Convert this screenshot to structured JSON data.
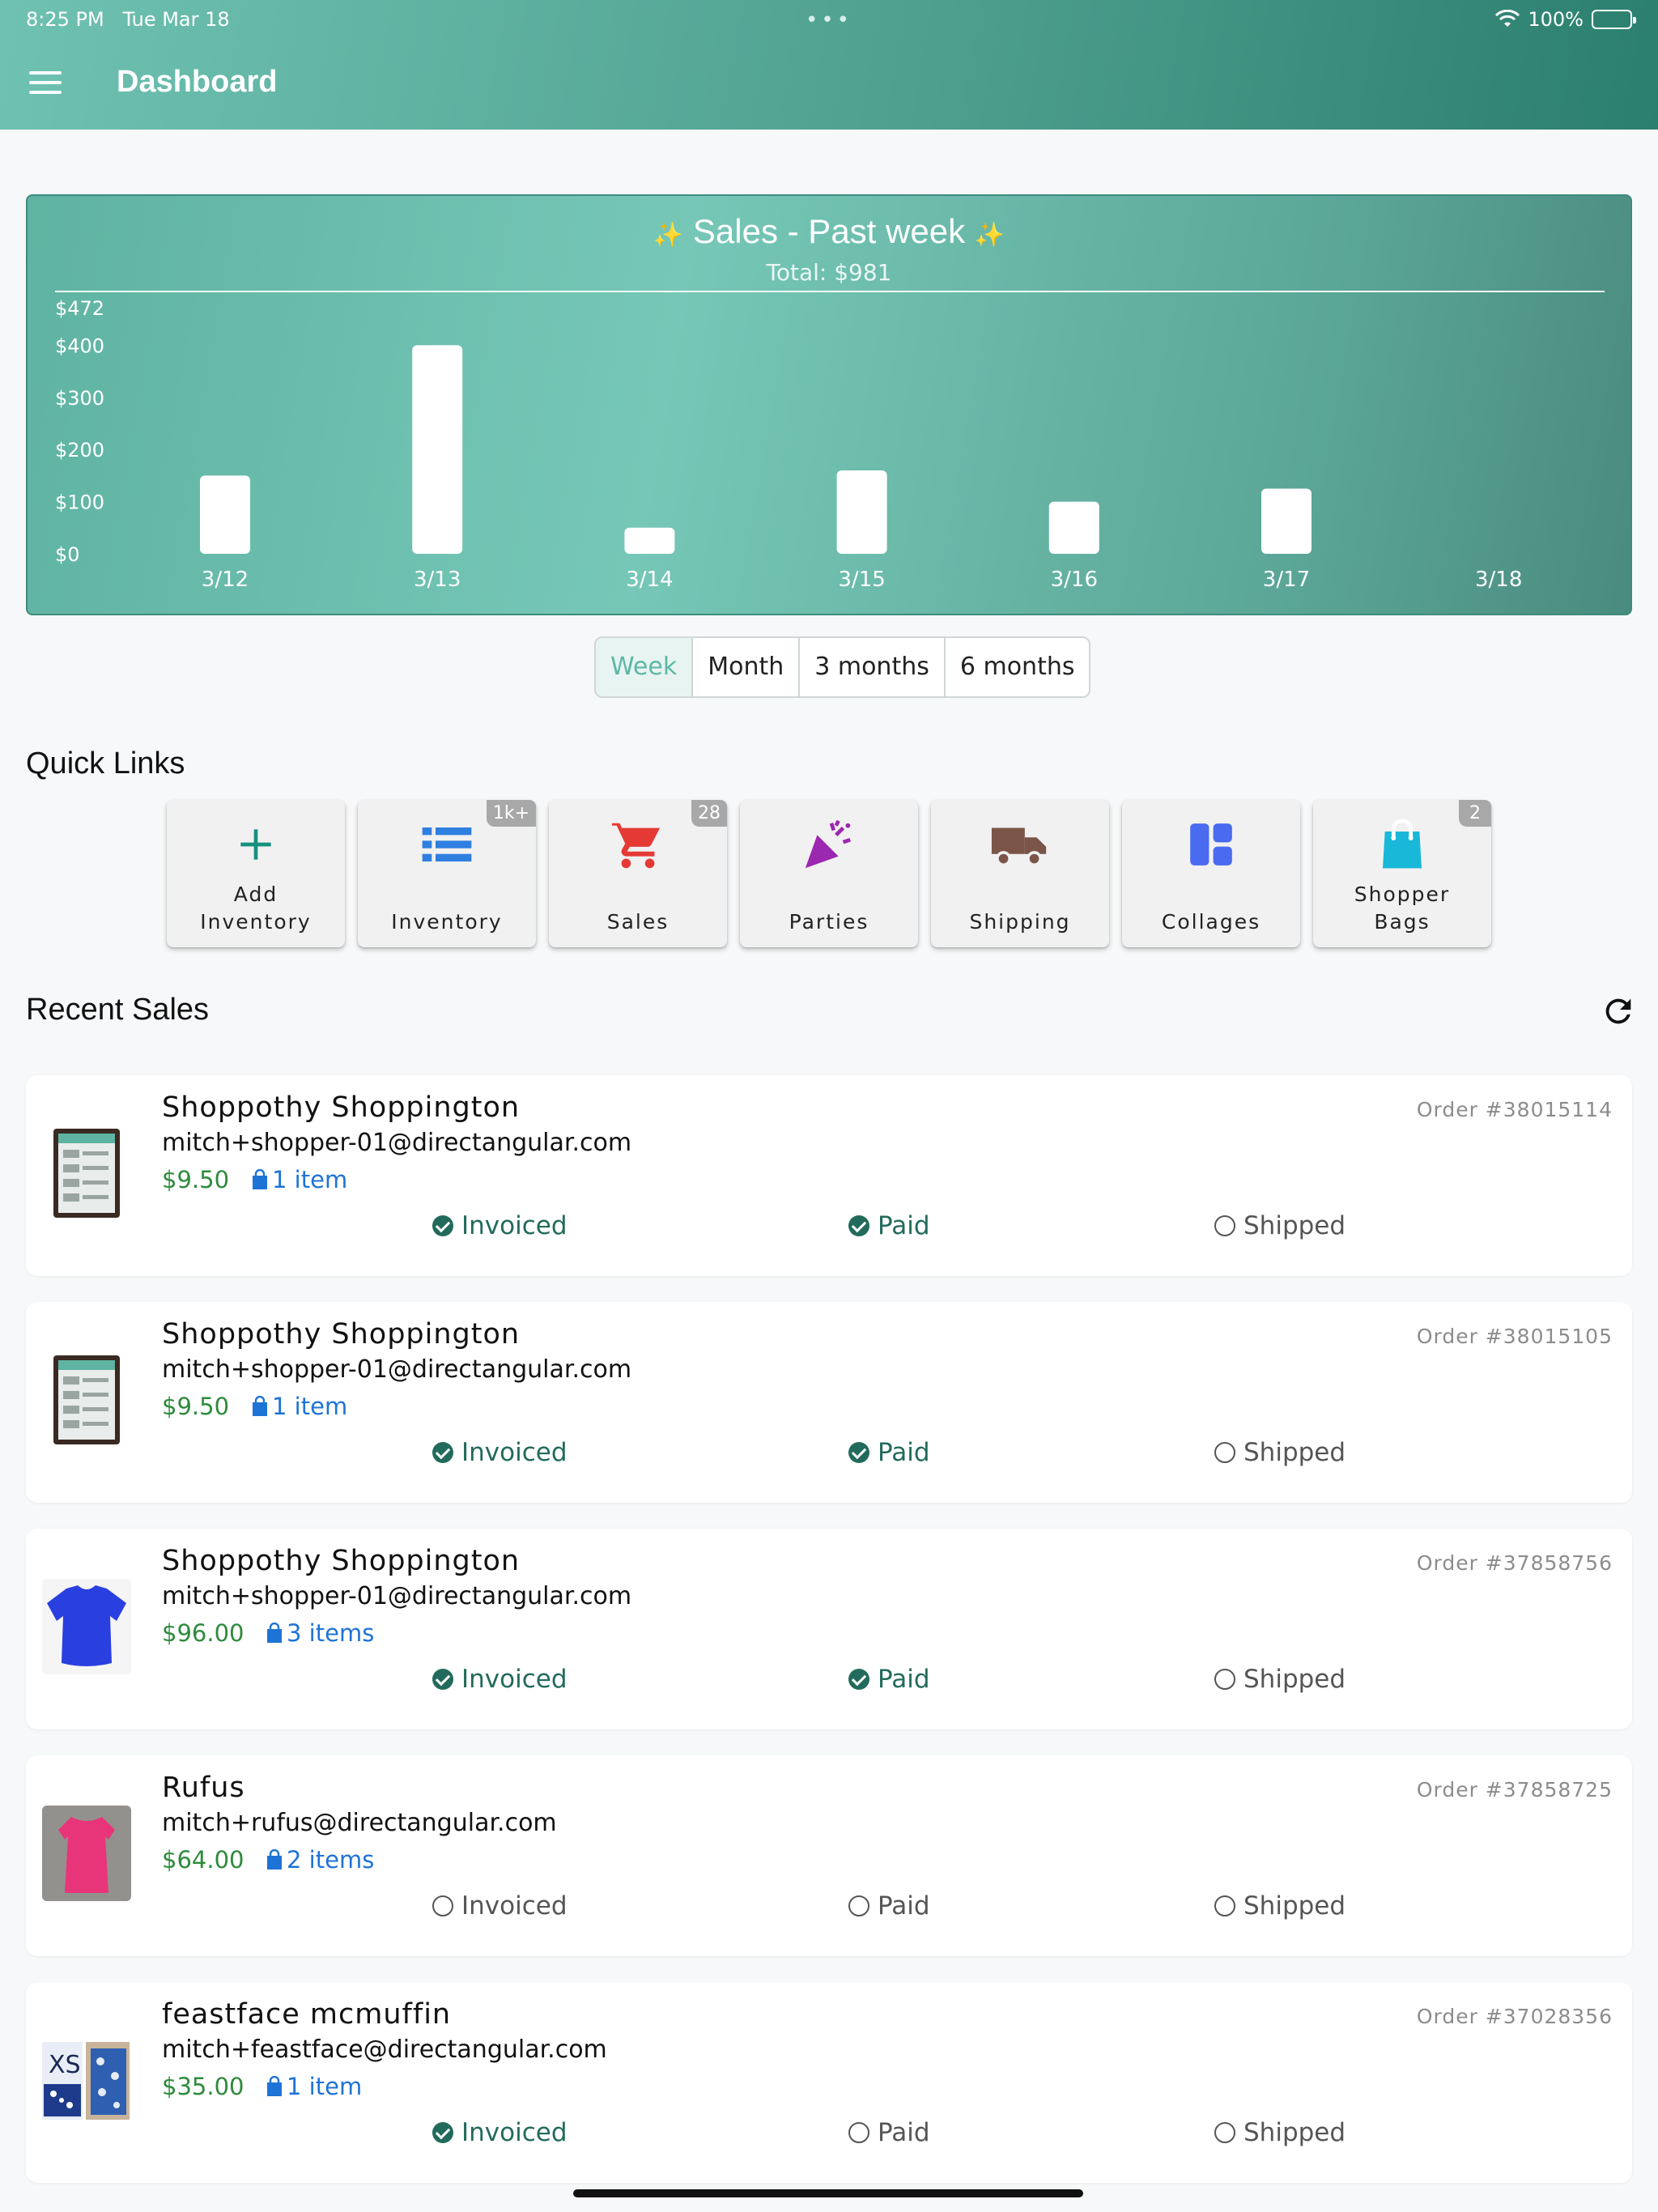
{
  "status_bar": {
    "time": "8:25 PM",
    "date": "Tue Mar 18",
    "battery": "100%"
  },
  "header": {
    "title": "Dashboard"
  },
  "chart_data": {
    "type": "bar",
    "title": "Sales - Past week",
    "subtitle": "Total: $981",
    "categories": [
      "3/12",
      "3/13",
      "3/14",
      "3/15",
      "3/16",
      "3/17",
      "3/18"
    ],
    "values": [
      150,
      400,
      50,
      160,
      100,
      125,
      0
    ],
    "y_ticks": [
      "$472",
      "$400",
      "$300",
      "$200",
      "$100",
      "$0"
    ],
    "ylim": [
      0,
      472
    ],
    "grid": false,
    "colors": {
      "bar": "#ffffff",
      "background": "#6dbfae"
    }
  },
  "range_tabs": {
    "items": [
      "Week",
      "Month",
      "3 months",
      "6 months"
    ],
    "active": "Week"
  },
  "quick_links": {
    "heading": "Quick Links",
    "items": [
      {
        "line1": "Add",
        "line2": "Inventory",
        "badge": "",
        "icon": "plus-icon",
        "color": "#16907f"
      },
      {
        "line1": "",
        "line2": "Inventory",
        "badge": "1k+",
        "icon": "list-icon",
        "color": "#2f7fe0"
      },
      {
        "line1": "",
        "line2": "Sales",
        "badge": "28",
        "icon": "cart-icon",
        "color": "#e53935"
      },
      {
        "line1": "",
        "line2": "Parties",
        "badge": "",
        "icon": "party-popper-icon",
        "color": "#9c27b0"
      },
      {
        "line1": "",
        "line2": "Shipping",
        "badge": "",
        "icon": "truck-icon",
        "color": "#7a5548"
      },
      {
        "line1": "",
        "line2": "Collages",
        "badge": "",
        "icon": "collage-icon",
        "color": "#4a6bf0"
      },
      {
        "line1": "Shopper",
        "line2": "Bags",
        "badge": "2",
        "icon": "shopping-bag-icon",
        "color": "#19b8d8"
      }
    ]
  },
  "recent_sales": {
    "heading": "Recent Sales",
    "status_labels": {
      "invoiced": "Invoiced",
      "paid": "Paid",
      "shipped": "Shipped"
    },
    "items": [
      {
        "name": "Shoppothy Shoppington",
        "email": "mitch+shopper-01@directangular.com",
        "price": "$9.50",
        "items": "1 item",
        "order": "Order #38015114",
        "invoiced": true,
        "paid": true,
        "shipped": false,
        "thumb": "phone"
      },
      {
        "name": "Shoppothy Shoppington",
        "email": "mitch+shopper-01@directangular.com",
        "price": "$9.50",
        "items": "1 item",
        "order": "Order #38015105",
        "invoiced": true,
        "paid": true,
        "shipped": false,
        "thumb": "phone"
      },
      {
        "name": "Shoppothy Shoppington",
        "email": "mitch+shopper-01@directangular.com",
        "price": "$96.00",
        "items": "3 items",
        "order": "Order #37858756",
        "invoiced": true,
        "paid": true,
        "shipped": false,
        "thumb": "blue-shirt"
      },
      {
        "name": "Rufus",
        "email": "mitch+rufus@directangular.com",
        "price": "$64.00",
        "items": "2 items",
        "order": "Order #37858725",
        "invoiced": false,
        "paid": false,
        "shipped": false,
        "thumb": "pink-dress"
      },
      {
        "name": "feastface mcmuffin",
        "email": "mitch+feastface@directangular.com",
        "price": "$35.00",
        "items": "1 item",
        "order": "Order #37028356",
        "invoiced": true,
        "paid": false,
        "shipped": false,
        "thumb": "collage",
        "thumb_text": "XS"
      }
    ]
  }
}
